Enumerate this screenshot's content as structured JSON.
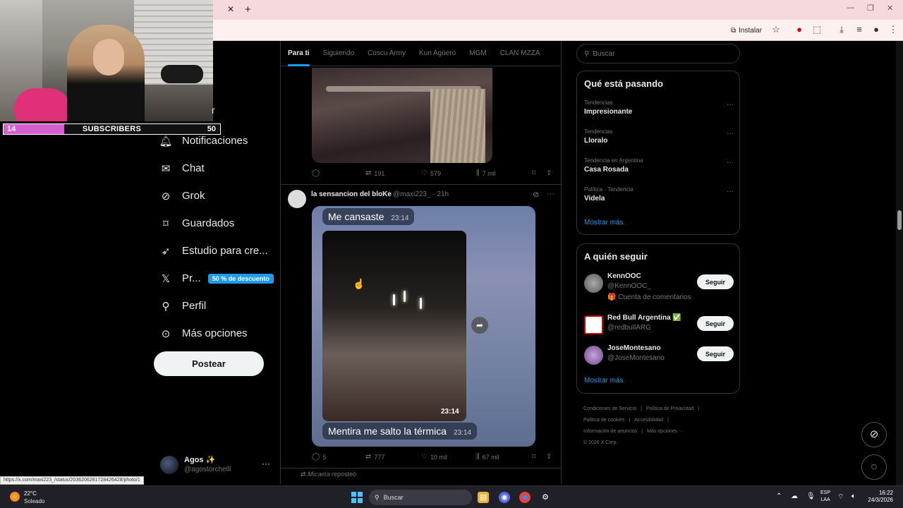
{
  "browser": {
    "tab_close": "✕",
    "new_tab": "+",
    "install_label": "Instalar"
  },
  "stream": {
    "subs_current": "14",
    "subs_label": "SUBSCRIBERS",
    "subs_goal": "50",
    "subs_progress": 0.28
  },
  "sidebar": {
    "partial_item": "r",
    "items": [
      {
        "label": "Notificaciones",
        "icon": "bell-icon"
      },
      {
        "label": "Chat",
        "icon": "envelope-icon"
      },
      {
        "label": "Grok",
        "icon": "grok-icon"
      },
      {
        "label": "Guardados",
        "icon": "bookmark-icon"
      },
      {
        "label": "Estudio para cre...",
        "icon": "rocket-icon"
      },
      {
        "label": "Pr...",
        "icon": "x-logo-icon",
        "badge": "50 % de descuento"
      },
      {
        "label": "Perfil",
        "icon": "person-icon"
      },
      {
        "label": "Más opciones",
        "icon": "more-circle-icon"
      }
    ],
    "post_button": "Postear",
    "account": {
      "name": "Agos ✨",
      "handle": "@agostorchelll",
      "more": "···"
    }
  },
  "status_bar_url": "https://x.com/maxi223_/status/2036206281728426428/photo/1",
  "feed": {
    "tabs": [
      "Para ti",
      "Siguiendo",
      "Coscu Army",
      "Kun Agüero",
      "MGM",
      "CLAN MZZA"
    ],
    "active_tab": 0,
    "post1": {
      "replies": "",
      "reposts": "191",
      "likes": "579",
      "views": "7 mil"
    },
    "post2": {
      "name": "la sensancion del bloKe",
      "handle_time": "@maxi223_ · 21h",
      "bubble_top": "Me cansaste",
      "bubble_top_time": "23:14",
      "inner_time": "23:14",
      "bubble_bottom": "Mentira me salto la térmica",
      "bubble_bottom_time": "23:14",
      "replies": "5",
      "reposts": "777",
      "likes": "10 mil",
      "views": "67 mil"
    },
    "repost_label": "𝑀𝑖𝑐𝑎𝑒𝑙𝑎 reposteó"
  },
  "right": {
    "search_placeholder": "Buscar",
    "trends_title": "Qué está pasando",
    "trends": [
      {
        "category": "Tendencias",
        "name": "Impresionante"
      },
      {
        "category": "Tendencias",
        "name": "Lloralo"
      },
      {
        "category": "Tendencia en Argentina",
        "name": "Casa Rosada"
      },
      {
        "category": "Política · Tendencia",
        "name": "Videla"
      }
    ],
    "show_more": "Mostrar más",
    "follow_title": "A quién seguir",
    "follow": [
      {
        "name": "KennOOC",
        "handle": "@KennOOC_",
        "note": "🎁 Cuenta de comentarios",
        "button": "Seguir"
      },
      {
        "name": "Red Bull Argentina ✅",
        "handle": "@redbullARG",
        "note": "",
        "button": "Seguir"
      },
      {
        "name": "JoseMontesano",
        "handle": "@JoseMontesano",
        "note": "",
        "button": "Seguir"
      }
    ],
    "footer": [
      "Condiciones de Servicio",
      "|",
      "Política de Privacidad",
      "|",
      "Política de cookies",
      "|",
      "Accesibilidad",
      "|",
      "Información de anuncios",
      "|",
      "Más opciones ···",
      "© 2026 X Corp."
    ]
  },
  "taskbar": {
    "temp": "22°C",
    "weather": "Soleado",
    "search": "Buscar",
    "lang1": "ESP",
    "lang2": "LAA",
    "time": "16:22",
    "date": "24/3/2026"
  },
  "colors": {
    "accent": "#1d9bf0",
    "bg": "#000000",
    "sub_fill": "#d65fd0"
  }
}
